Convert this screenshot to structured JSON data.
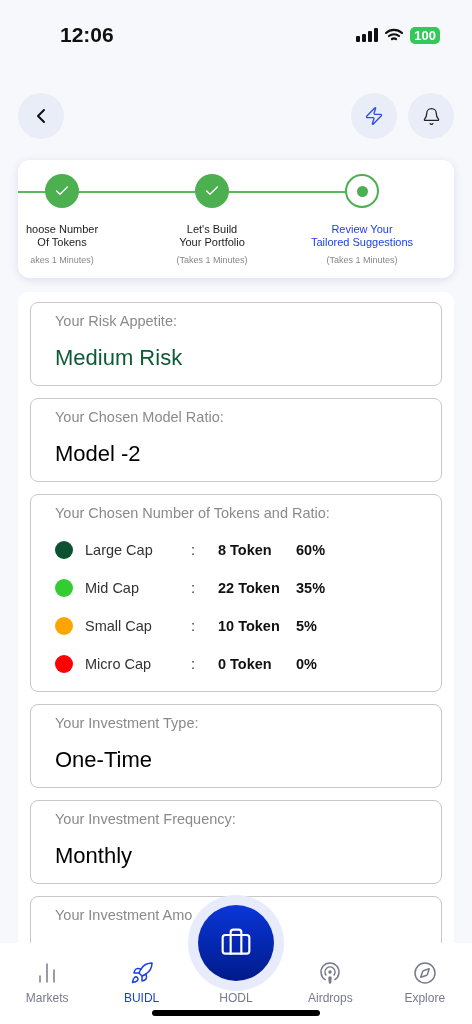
{
  "status_bar": {
    "time": "12:06",
    "battery": "100"
  },
  "steps": [
    {
      "title": [
        "hoose Number",
        "Of Tokens"
      ],
      "note": "akes 1 Minutes)",
      "done": true
    },
    {
      "title": [
        "Let's Build",
        "Your Portfolio"
      ],
      "note": "(Takes 1 Minutes)",
      "done": true
    },
    {
      "title": [
        "Review Your",
        "Tailored Suggestions"
      ],
      "note": "(Takes 1 Minutes)",
      "done": false
    }
  ],
  "cards": [
    {
      "kind": "value",
      "label": "Your Risk Appetite:",
      "value": "Medium Risk",
      "color": "#0d5a36"
    },
    {
      "kind": "value",
      "label": "Your Chosen Model Ratio:",
      "value": "Model -2",
      "color": "#000000"
    },
    {
      "kind": "tokens",
      "label": "Your Chosen Number of Tokens and Ratio:",
      "rows": [
        {
          "name": "Large Cap",
          "sep": ":",
          "count": "8 Token",
          "ratio": "60%",
          "color": "#0b5132"
        },
        {
          "name": "Mid Cap",
          "sep": ":",
          "count": "22 Token",
          "ratio": "35%",
          "color": "#33cc33"
        },
        {
          "name": "Small Cap",
          "sep": ":",
          "count": "10 Token",
          "ratio": "5%",
          "color": "#ffa500"
        },
        {
          "name": "Micro Cap",
          "sep": ":",
          "count": "0 Token",
          "ratio": "0%",
          "color": "#ff0000"
        }
      ]
    },
    {
      "kind": "value",
      "label": "Your Investment Type:",
      "value": "One-Time",
      "color": "#000000"
    },
    {
      "kind": "value",
      "label": "Your Investment Frequency:",
      "value": "Monthly",
      "color": "#000000"
    },
    {
      "kind": "partial",
      "label": "Your Investment Amo"
    }
  ],
  "nav": [
    {
      "label": "Markets",
      "selected": false
    },
    {
      "label": "BUIDL",
      "selected": true
    },
    {
      "label": "HODL",
      "selected": false
    },
    {
      "label": "Airdrops",
      "selected": false
    },
    {
      "label": "Explore",
      "selected": false
    }
  ]
}
